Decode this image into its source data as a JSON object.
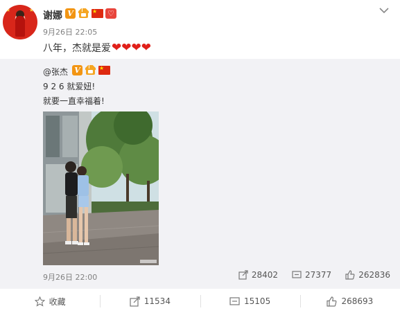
{
  "post": {
    "username": "谢娜",
    "timestamp": "9月26日 22:05",
    "text": "八年，杰就是爱",
    "hearts_count": 4
  },
  "repost": {
    "username": "@张杰",
    "line1": "9 2 6 就爱妞!",
    "line2": "就要一直幸福着!",
    "timestamp": "9月26日 22:00",
    "reposts": "28402",
    "comments": "27377",
    "likes": "262836"
  },
  "actions": {
    "favorite_label": "收藏",
    "repost_count": "11534",
    "comment_count": "15105",
    "like_count": "268693"
  },
  "colors": {
    "vip_badge": "#f29513",
    "heart": "#e0201a",
    "flag": "#de2910",
    "repost_bg": "#f2f2f5"
  },
  "icons": [
    "v-verified-icon",
    "crown-icon",
    "china-flag-icon",
    "heart-badge-icon",
    "chevron-down-icon",
    "repost-icon",
    "comment-icon",
    "like-icon",
    "star-icon"
  ]
}
